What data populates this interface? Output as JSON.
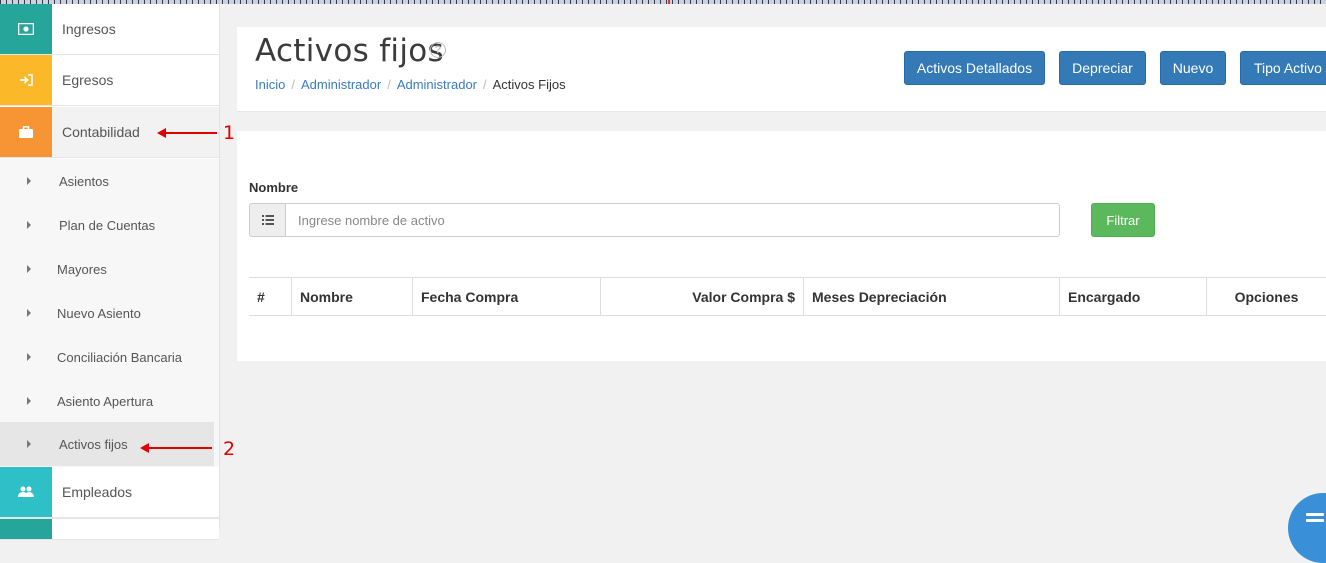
{
  "sidebar": {
    "main_items": [
      {
        "label": "Ingresos",
        "icon": "money-icon",
        "color": "#26a69a"
      },
      {
        "label": "Egresos",
        "icon": "sign-in-icon",
        "color": "#fbb829"
      },
      {
        "label": "Contabilidad",
        "icon": "briefcase-icon",
        "color": "#f79433"
      }
    ],
    "sub_items": [
      {
        "label": "Asientos"
      },
      {
        "label": "Plan de Cuentas"
      },
      {
        "label": "Mayores"
      },
      {
        "label": "Nuevo Asiento"
      },
      {
        "label": "Conciliación Bancaria"
      },
      {
        "label": "Asiento Apertura"
      },
      {
        "label": "Activos fijos"
      }
    ],
    "after_items": [
      {
        "label": "Empleados",
        "icon": "users-icon",
        "color": "#2fbfc6"
      }
    ]
  },
  "annotations": [
    "1",
    "2"
  ],
  "header": {
    "title": "Activos fijos",
    "help_symbol": "?",
    "breadcrumb": [
      "Inicio",
      "Administrador",
      "Administrador",
      "Activos Fijos"
    ],
    "separator": "/",
    "buttons": [
      "Activos Detallados",
      "Depreciar",
      "Nuevo",
      "Tipo Activo"
    ]
  },
  "filter": {
    "label": "Nombre",
    "placeholder": "Ingrese nombre de activo",
    "button": "Filtrar"
  },
  "table": {
    "columns": [
      "#",
      "Nombre",
      "Fecha Compra",
      "Valor Compra $",
      "Meses Depreciación",
      "Encargado",
      "Opciones"
    ]
  },
  "colors": {
    "primary": "#337ab7",
    "success": "#5cb85c",
    "annotation": "#e00000"
  }
}
